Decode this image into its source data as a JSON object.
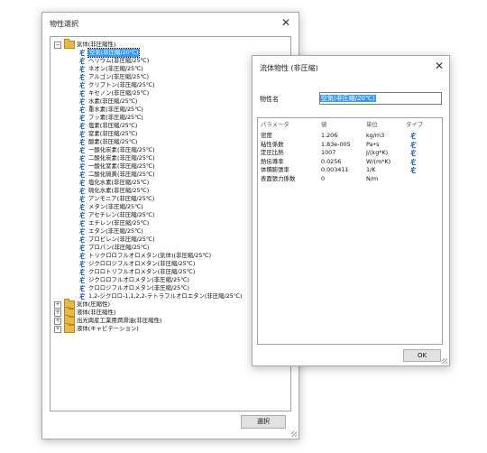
{
  "select_dialog": {
    "title": "物性選択",
    "close_glyph": "✕",
    "select_button": "選択",
    "tree": [
      {
        "label": "気体(非圧縮性)",
        "expanded": true,
        "children": [
          "空気(非圧縮/20℃)",
          "ヘリウム(非圧縮/25℃)",
          "ネオン(非圧縮/25℃)",
          "アルゴン(非圧縮/25℃)",
          "クリプトン(非圧縮/25℃)",
          "キセノン(非圧縮/25℃)",
          "水素(非圧縮/25℃)",
          "重水素(非圧縮/25℃)",
          "フッ素(非圧縮/25℃)",
          "塩素(非圧縮/25℃)",
          "窒素(非圧縮/25℃)",
          "酸素(非圧縮/25℃)",
          "一酸化炭素(非圧縮/25℃)",
          "二酸化炭素(非圧縮/25℃)",
          "一酸化窒素(非圧縮/25℃)",
          "二酸化硫黄(非圧縮/25℃)",
          "塩化水素(非圧縮/25℃)",
          "硫化水素(非圧縮/25℃)",
          "アンモニア(非圧縮/25℃)",
          "メタン(非圧縮/25℃)",
          "アセチレン(非圧縮/25℃)",
          "エチレン(非圧縮/25℃)",
          "エタン(非圧縮/25℃)",
          "プロピレン(非圧縮/25℃)",
          "プロパン(非圧縮/25℃)",
          "トリクロロフルオロメタン(気体)(非圧縮/25℃)",
          "ジクロロジフルオロメタン(非圧縮/25℃)",
          "クロロトリフルオロメタン(非圧縮/25℃)",
          "ジクロロフルオロメタン(非圧縮/25℃)",
          "クロロジフルオロメタン(非圧縮/25℃)",
          "1,2-ジクロロ-1,1,2,2-テトラフルオロエタン(非圧縮/25℃)"
        ]
      },
      {
        "label": "気体(圧縮性)",
        "expanded": false,
        "children": []
      },
      {
        "label": "液体(非圧縮性)",
        "expanded": false,
        "children": []
      },
      {
        "label": "出光興産工業用潤滑油(非圧縮性)",
        "expanded": false,
        "children": []
      },
      {
        "label": "液体(キャビテーション)",
        "expanded": false,
        "children": []
      }
    ],
    "selected_item": "空気(非圧縮/20℃)"
  },
  "property_dialog": {
    "title": "流体物性 (非圧縮)",
    "close_glyph": "✕",
    "name_label": "物性名",
    "name_value": "空気(非圧縮/20℃)",
    "columns": [
      "パラメータ",
      "値",
      "単位",
      "タイプ"
    ],
    "rows": [
      {
        "param": "密度",
        "value": "1.206",
        "unit": "kg/m3",
        "type_icon": "tap-icon"
      },
      {
        "param": "粘性係数",
        "value": "1.83e-005",
        "unit": "Pa•s",
        "type_icon": "tap-icon"
      },
      {
        "param": "定圧比熱",
        "value": "1007",
        "unit": "J/(kg*K)",
        "type_icon": "tap-icon"
      },
      {
        "param": "熱伝導率",
        "value": "0.0256",
        "unit": "W/(m*K)",
        "type_icon": "tap-icon"
      },
      {
        "param": "体積膨張率",
        "value": "0.003411",
        "unit": "1/K",
        "type_icon": "tap-icon"
      },
      {
        "param": "表面張力係数",
        "value": "0",
        "unit": "N/m",
        "type_icon": ""
      }
    ],
    "ok_button": "OK"
  },
  "colors": {
    "selection": "#3399ff",
    "folder": "#e8b84a",
    "tap_icon": "#1f5fae"
  }
}
